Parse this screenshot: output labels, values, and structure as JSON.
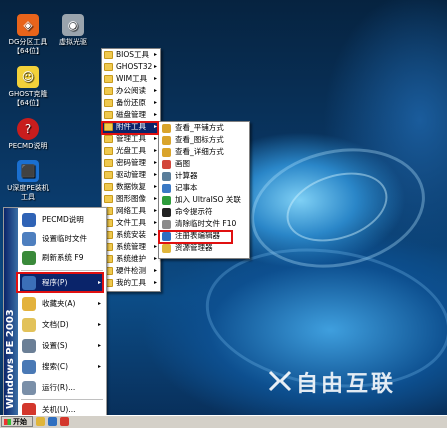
{
  "desktop_icons": [
    {
      "label": "DG分区工具\n【64位】",
      "icon": "partition-tool-icon",
      "color": "#e8641b"
    },
    {
      "label": "虚拟光驱",
      "icon": "virtual-drive-icon",
      "color": "#9aa4ad"
    },
    {
      "label": "GHOST克隆\n【64位】",
      "icon": "ghost-icon",
      "color": "#f2d13a"
    },
    {
      "label": "PECMD说明",
      "icon": "help-icon",
      "color": "#c81d1d"
    },
    {
      "label": "U深度PE装机\n工具",
      "icon": "installer-icon",
      "color": "#1a6fd0"
    }
  ],
  "programs_menu": [
    {
      "label": "BIOS工具",
      "arrow": "▸",
      "highlighted": false
    },
    {
      "label": "GHOST32",
      "arrow": "▸",
      "highlighted": false
    },
    {
      "label": "WIM工具",
      "arrow": "▸",
      "highlighted": false
    },
    {
      "label": "办公阅读",
      "arrow": "▸",
      "highlighted": false
    },
    {
      "label": "备份还原",
      "arrow": "▸",
      "highlighted": false
    },
    {
      "label": "磁盘管理",
      "arrow": "▸",
      "highlighted": false
    },
    {
      "label": "附件工具",
      "arrow": "▸",
      "highlighted": true
    },
    {
      "label": "管理工具",
      "arrow": "▸",
      "highlighted": false
    },
    {
      "label": "光盘工具",
      "arrow": "▸",
      "highlighted": false
    },
    {
      "label": "密码管理",
      "arrow": "▸",
      "highlighted": false
    },
    {
      "label": "驱动管理",
      "arrow": "▸",
      "highlighted": false
    },
    {
      "label": "数据恢复",
      "arrow": "▸",
      "highlighted": false
    },
    {
      "label": "图形图像",
      "arrow": "▸",
      "highlighted": false
    },
    {
      "label": "网络工具",
      "arrow": "▸",
      "highlighted": false
    },
    {
      "label": "文件工具",
      "arrow": "▸",
      "highlighted": false
    },
    {
      "label": "系统安装",
      "arrow": "▸",
      "highlighted": false
    },
    {
      "label": "系统管理",
      "arrow": "▸",
      "highlighted": false
    },
    {
      "label": "系统维护",
      "arrow": "▸",
      "highlighted": false
    },
    {
      "label": "硬件检测",
      "arrow": "▸",
      "highlighted": false
    },
    {
      "label": "我的工具",
      "arrow": "▸",
      "highlighted": false
    }
  ],
  "accessories_menu": [
    {
      "label": "查看_平铺方式",
      "icon": "view-icon",
      "color": "#d9a42b"
    },
    {
      "label": "查看_图标方式",
      "icon": "view-icon",
      "color": "#d9a42b"
    },
    {
      "label": "查看_详细方式",
      "icon": "view-icon",
      "color": "#d9a42b"
    },
    {
      "label": "画图",
      "icon": "paint-icon",
      "color": "#d2463a"
    },
    {
      "label": "计算器",
      "icon": "calculator-icon",
      "color": "#5a7d9a"
    },
    {
      "label": "记事本",
      "icon": "notepad-icon",
      "color": "#3a79c4"
    },
    {
      "label": "加入 UltraISO 关联",
      "icon": "ultraiso-icon",
      "color": "#2d9c3b"
    },
    {
      "label": "命令提示符",
      "icon": "cmd-icon",
      "color": "#222222"
    },
    {
      "label": "清除临时文件 F10",
      "icon": "clean-icon",
      "color": "#8a8a8a"
    },
    {
      "label": "注册表编辑器",
      "icon": "regedit-icon",
      "color": "#2f6fc0"
    },
    {
      "label": "资源管理器",
      "icon": "explorer-icon",
      "color": "#e0b53a"
    }
  ],
  "start_menu": {
    "side_title": "Windows PE 2003",
    "top_items": [
      {
        "label": "PECMD说明",
        "icon": "help-icon",
        "color": "#2f63b6"
      },
      {
        "label": "设置临时文件",
        "icon": "settings-icon",
        "color": "#4e7fbf"
      },
      {
        "label": "刷新系统 F9",
        "icon": "refresh-icon",
        "color": "#3a8a3a"
      }
    ],
    "items": [
      {
        "label": "程序(P)",
        "icon": "programs-icon",
        "color": "#3b6fb8",
        "arrow": "▸",
        "highlighted": true
      },
      {
        "label": "收藏夹(A)",
        "icon": "favorites-icon",
        "color": "#e3b23c",
        "arrow": "▸",
        "highlighted": false
      },
      {
        "label": "文档(D)",
        "icon": "documents-icon",
        "color": "#e2c25a",
        "arrow": "▸",
        "highlighted": false
      },
      {
        "label": "设置(S)",
        "icon": "settings-icon",
        "color": "#6b7f96",
        "arrow": "▸",
        "highlighted": false
      },
      {
        "label": "搜索(C)",
        "icon": "search-icon",
        "color": "#4a79b5",
        "arrow": "▸",
        "highlighted": false
      },
      {
        "label": "运行(R)...",
        "icon": "run-icon",
        "color": "#7a8fa8",
        "arrow": "",
        "highlighted": false
      }
    ],
    "shutdown": {
      "label": "关机(U)...",
      "icon": "shutdown-icon",
      "color": "#d3372c"
    }
  },
  "taskbar": {
    "start_label": "开始"
  },
  "watermark": {
    "text": "自由互联"
  }
}
